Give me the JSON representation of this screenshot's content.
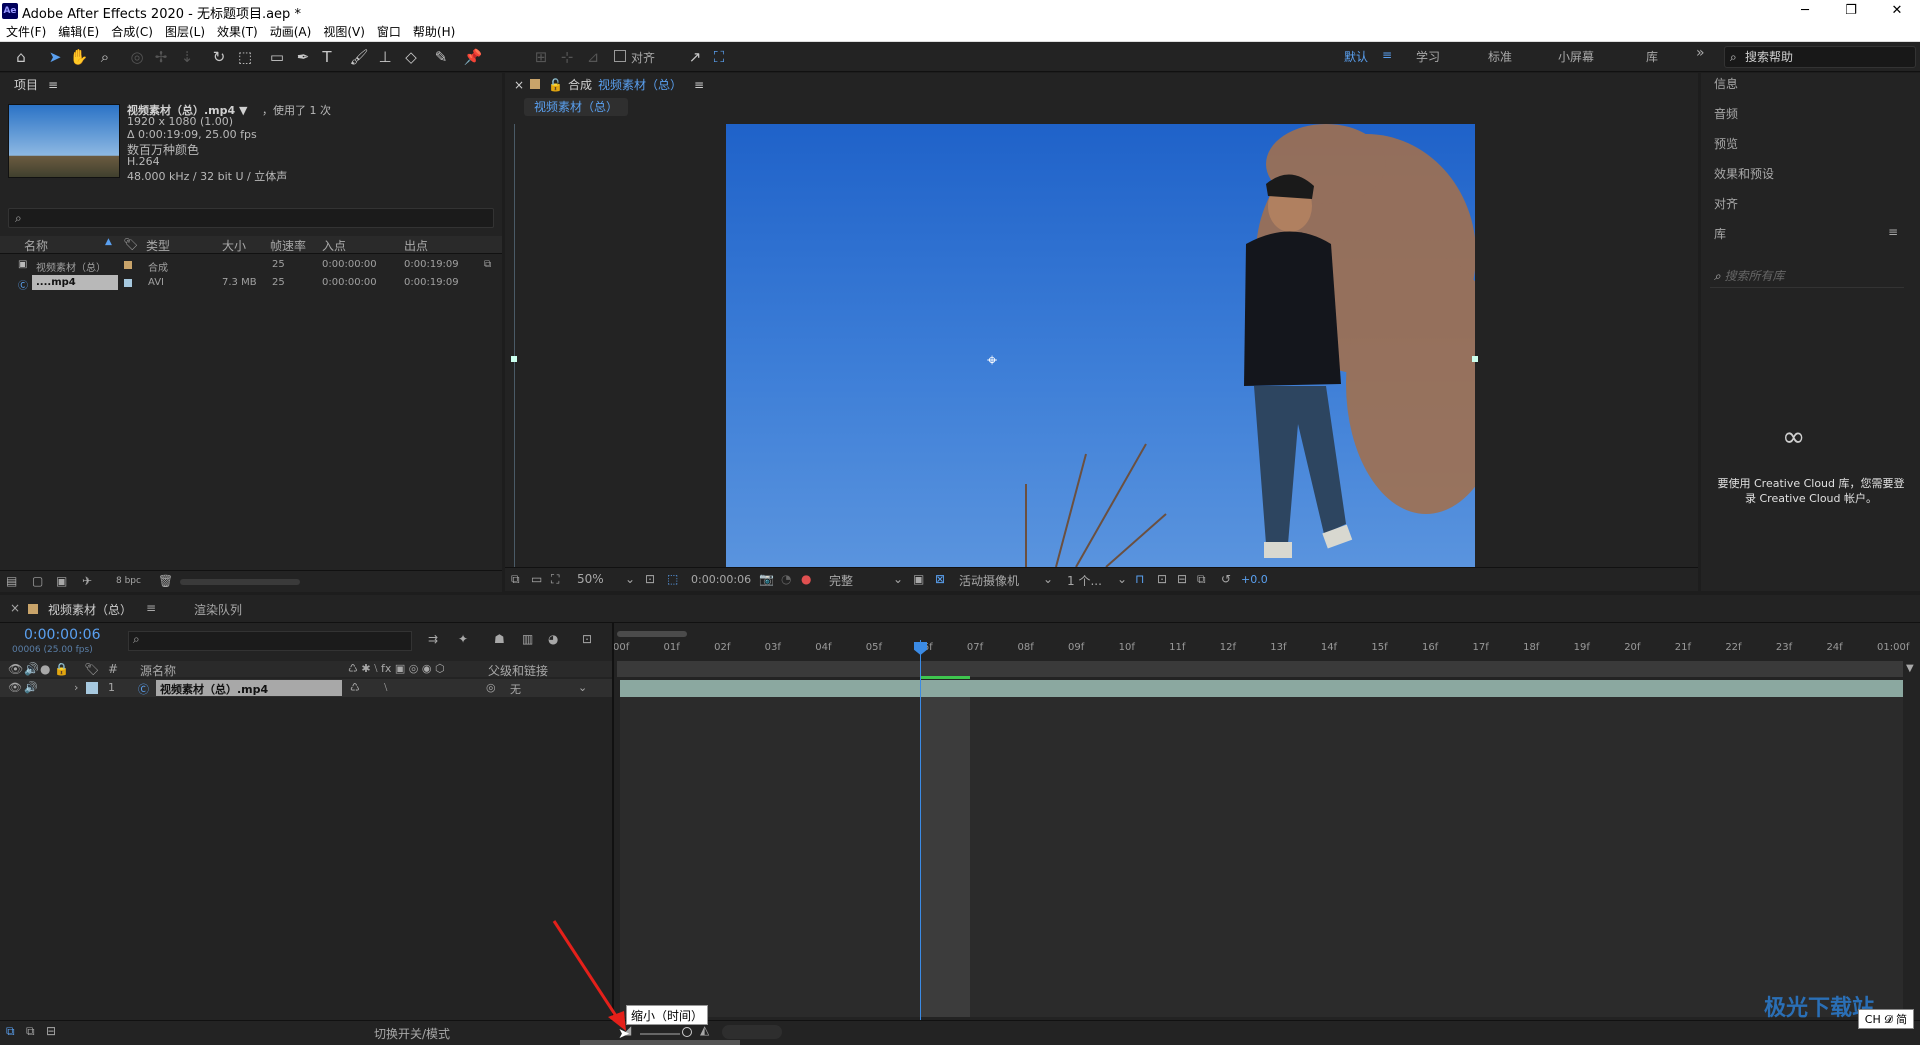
{
  "window": {
    "title": "Adobe After Effects 2020 - 无标题项目.aep *",
    "logo": "Ae"
  },
  "menu": [
    "文件(F)",
    "编辑(E)",
    "合成(C)",
    "图层(L)",
    "效果(T)",
    "动画(A)",
    "视图(V)",
    "窗口",
    "帮助(H)"
  ],
  "toolbar": {
    "align_label": "对齐",
    "workspaces": [
      "默认",
      "学习",
      "标准",
      "小屏幕",
      "库"
    ],
    "search_help": "搜索帮助"
  },
  "project": {
    "title": "项目",
    "item_name": "视频素材（总）.mp4 ▼",
    "used": "，使用了 1 次",
    "resolution": "1920 x 1080 (1.00)",
    "duration": "Δ 0:00:19:09, 25.00 fps",
    "colors": "数百万种颜色",
    "codec": "H.264",
    "audio": "48.000 kHz / 32 bit U / 立体声",
    "columns": [
      "名称",
      "类型",
      "大小",
      "帧速率",
      "入点",
      "出点"
    ],
    "rows": [
      {
        "name": "视频素材（总）",
        "type": "合成",
        "size": "",
        "fps": "25",
        "in": "0:00:00:00",
        "out": "0:00:19:09"
      },
      {
        "name": "....mp4",
        "type": "AVI",
        "size": "7.3 MB",
        "fps": "25",
        "in": "0:00:00:00",
        "out": "0:00:19:09"
      }
    ],
    "bpc": "8 bpc"
  },
  "comp": {
    "label": "合成",
    "name": "视频素材（总）",
    "tab": "视频素材（总）",
    "zoom": "50%",
    "time": "0:00:00:06",
    "quality": "完整",
    "camera": "活动摄像机",
    "views": "1 个...",
    "exposure": "+0.0"
  },
  "right_panel": {
    "items": [
      "信息",
      "音频",
      "预览",
      "效果和预设",
      "对齐",
      "库"
    ],
    "lib_search": "搜索所有库",
    "cc_msg1": "要使用 Creative Cloud 库，您需要登",
    "cc_msg2": "录 Creative Cloud 帐户。"
  },
  "timeline": {
    "tab": "视频素材（总）",
    "render_tab": "渲染队列",
    "timecode": "0:00:00:06",
    "frame_info": "00006 (25.00 fps)",
    "ruler": [
      "00f",
      "01f",
      "02f",
      "03f",
      "04f",
      "05f",
      "06f",
      "07f",
      "08f",
      "09f",
      "10f",
      "11f",
      "12f",
      "13f",
      "14f",
      "15f",
      "16f",
      "17f",
      "18f",
      "19f",
      "20f",
      "21f",
      "22f",
      "23f",
      "24f",
      "01:00f"
    ],
    "col_source": "源名称",
    "col_parent": "父级和链接",
    "layer_num": "1",
    "layer_name": "视频素材（总）.mp4",
    "parent": "无",
    "foot_label": "切换开关/模式",
    "tooltip": "缩小（时间）"
  },
  "watermark": "极光下载站",
  "ime": "CH 𝓓 简"
}
